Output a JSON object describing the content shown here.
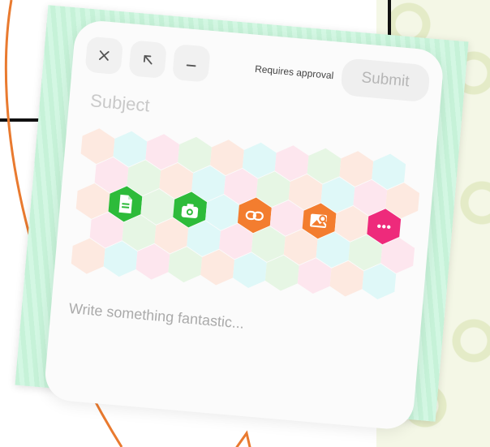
{
  "composer": {
    "close_icon": "close-icon",
    "expand_icon": "arrow-up-left-icon",
    "minimize_icon": "minimize-icon",
    "approval_text": "Requires approval",
    "submit_label": "Submit",
    "subject_placeholder": "Subject",
    "body_placeholder": "Write something fantastic..."
  },
  "attachments": [
    {
      "name": "document",
      "icon": "document-icon",
      "color": "#2dbb3a"
    },
    {
      "name": "camera",
      "icon": "camera-icon",
      "color": "#2dbb3a"
    },
    {
      "name": "link",
      "icon": "link-icon",
      "color": "#f37d2f"
    },
    {
      "name": "image-search",
      "icon": "image-search-icon",
      "color": "#f37d2f"
    },
    {
      "name": "more",
      "icon": "more-icon",
      "color": "#ee2a7b"
    }
  ],
  "colors": {
    "frame": "#c6f2d8",
    "card": "#fbfbfb",
    "hex_pink": "#fde6ee",
    "hex_peach": "#fde9e0",
    "hex_green": "#e6f6e4",
    "hex_cyan": "#dff8f8"
  }
}
